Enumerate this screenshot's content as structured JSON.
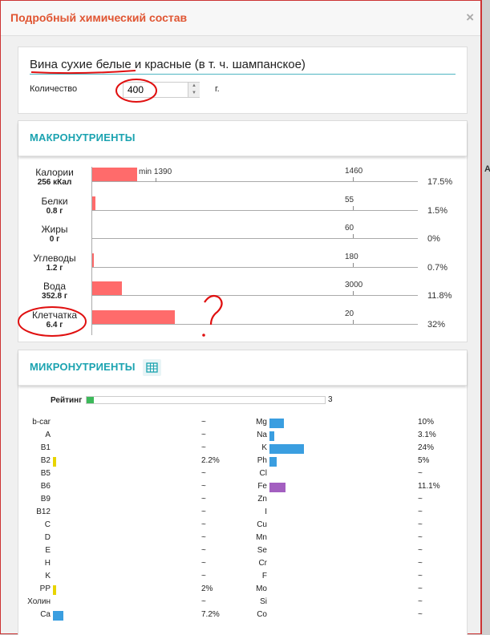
{
  "modal": {
    "title": "Подробный химический состав",
    "close_icon": "×"
  },
  "backdrop": {
    "side_text": "А"
  },
  "product": {
    "name": "Вина сухие белые и красные (в т. ч. шампанское)",
    "quantity_label": "Количество",
    "quantity_value": "400",
    "unit": "г."
  },
  "macro": {
    "title": "МАКРОНУТРИЕНТЫ",
    "min_label": "min 1390",
    "rows": [
      {
        "name": "Калории",
        "value": "256 кКал",
        "target": "1460",
        "percent": "17.5%",
        "fraction": 0.175
      },
      {
        "name": "Белки",
        "value": "0.8 г",
        "target": "55",
        "percent": "1.5%",
        "fraction": 0.015
      },
      {
        "name": "Жиры",
        "value": "0 г",
        "target": "60",
        "percent": "0%",
        "fraction": 0
      },
      {
        "name": "Углеводы",
        "value": "1.2 г",
        "target": "180",
        "percent": "0.7%",
        "fraction": 0.007
      },
      {
        "name": "Вода",
        "value": "352.8 г",
        "target": "3000",
        "percent": "11.8%",
        "fraction": 0.118
      },
      {
        "name": "Клетчатка",
        "value": "6.4 г",
        "target": "20",
        "percent": "32%",
        "fraction": 0.32
      }
    ]
  },
  "micro": {
    "title": "МИКРОНУТРИЕНТЫ",
    "table_icon": "grid-icon",
    "rating_label": "Рейтинг",
    "rating_value": "3",
    "rating_fraction": 0.03,
    "vitamins": [
      {
        "name": "b-car",
        "percent": "~",
        "fraction": 0,
        "color": ""
      },
      {
        "name": "A",
        "percent": "~",
        "fraction": 0,
        "color": ""
      },
      {
        "name": "B1",
        "percent": "~",
        "fraction": 0,
        "color": ""
      },
      {
        "name": "B2",
        "percent": "2.2%",
        "fraction": 0.022,
        "color": "#e8d400"
      },
      {
        "name": "B5",
        "percent": "~",
        "fraction": 0,
        "color": ""
      },
      {
        "name": "B6",
        "percent": "~",
        "fraction": 0,
        "color": ""
      },
      {
        "name": "B9",
        "percent": "~",
        "fraction": 0,
        "color": ""
      },
      {
        "name": "B12",
        "percent": "~",
        "fraction": 0,
        "color": ""
      },
      {
        "name": "C",
        "percent": "~",
        "fraction": 0,
        "color": ""
      },
      {
        "name": "D",
        "percent": "~",
        "fraction": 0,
        "color": ""
      },
      {
        "name": "E",
        "percent": "~",
        "fraction": 0,
        "color": ""
      },
      {
        "name": "H",
        "percent": "~",
        "fraction": 0,
        "color": ""
      },
      {
        "name": "K",
        "percent": "~",
        "fraction": 0,
        "color": ""
      },
      {
        "name": "PP",
        "percent": "2%",
        "fraction": 0.02,
        "color": "#e8d400"
      },
      {
        "name": "Холин",
        "percent": "~",
        "fraction": 0,
        "color": ""
      },
      {
        "name": "Ca",
        "percent": "7.2%",
        "fraction": 0.072,
        "color": "#3a9ee0"
      }
    ],
    "minerals": [
      {
        "name": "Mg",
        "percent": "10%",
        "fraction": 0.1,
        "color": "#3a9ee0"
      },
      {
        "name": "Na",
        "percent": "3.1%",
        "fraction": 0.031,
        "color": "#3a9ee0"
      },
      {
        "name": "K",
        "percent": "24%",
        "fraction": 0.24,
        "color": "#3a9ee0"
      },
      {
        "name": "Ph",
        "percent": "5%",
        "fraction": 0.05,
        "color": "#3a9ee0"
      },
      {
        "name": "Cl",
        "percent": "~",
        "fraction": 0,
        "color": ""
      },
      {
        "name": "Fe",
        "percent": "11.1%",
        "fraction": 0.111,
        "color": "#a35fc0"
      },
      {
        "name": "Zn",
        "percent": "~",
        "fraction": 0,
        "color": ""
      },
      {
        "name": "I",
        "percent": "~",
        "fraction": 0,
        "color": ""
      },
      {
        "name": "Cu",
        "percent": "~",
        "fraction": 0,
        "color": ""
      },
      {
        "name": "Mn",
        "percent": "~",
        "fraction": 0,
        "color": ""
      },
      {
        "name": "Se",
        "percent": "~",
        "fraction": 0,
        "color": ""
      },
      {
        "name": "Cr",
        "percent": "~",
        "fraction": 0,
        "color": ""
      },
      {
        "name": "F",
        "percent": "~",
        "fraction": 0,
        "color": ""
      },
      {
        "name": "Mo",
        "percent": "~",
        "fraction": 0,
        "color": ""
      },
      {
        "name": "Si",
        "percent": "~",
        "fraction": 0,
        "color": ""
      },
      {
        "name": "Co",
        "percent": "~",
        "fraction": 0,
        "color": ""
      }
    ]
  },
  "annotations": {
    "question_mark": "?"
  },
  "colors": {
    "accent": "#1ba3b0",
    "title": "#e05532",
    "macro_bar": "#ff6b6b",
    "annotation": "#e01010"
  }
}
